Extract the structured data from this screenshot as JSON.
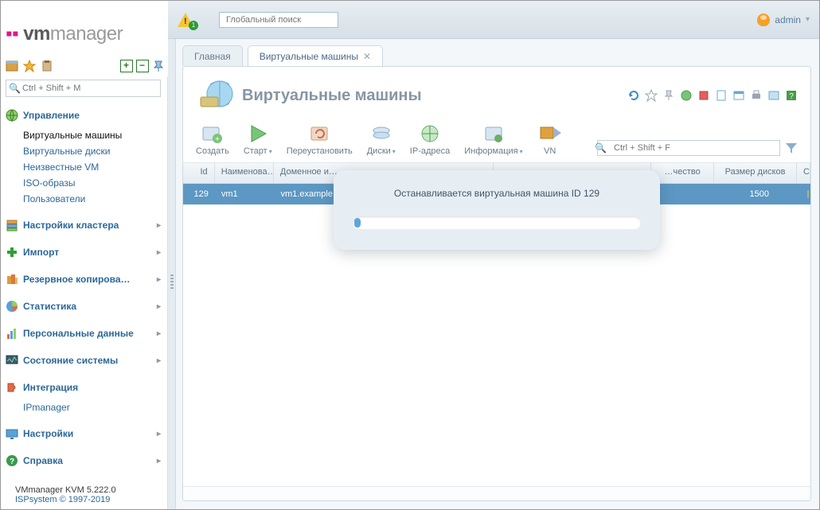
{
  "header": {
    "alert_count": "1",
    "search_placeholder": "Глобальный поиск",
    "user": "admin"
  },
  "logo": {
    "brand_prefix_symbol": "▪▪",
    "brand_bold": "vm",
    "brand_rest": "manager"
  },
  "mini_toolbar": {},
  "sidebar": {
    "search_placeholder": "Ctrl + Shift + M",
    "sections": [
      {
        "title": "Управление",
        "expandable": false,
        "items": [
          "Виртуальные машины",
          "Виртуальные диски",
          "Неизвестные VM",
          "ISO-образы",
          "Пользователи"
        ],
        "active_index": 0
      },
      {
        "title": "Настройки кластера",
        "expandable": true
      },
      {
        "title": "Импорт",
        "expandable": true
      },
      {
        "title": "Резервное копирова…",
        "expandable": true
      },
      {
        "title": "Статистика",
        "expandable": true
      },
      {
        "title": "Персональные данные",
        "expandable": true
      },
      {
        "title": "Состояние системы",
        "expandable": true
      },
      {
        "title": "Интеграция",
        "expandable": false,
        "items": [
          "IPmanager"
        ]
      },
      {
        "title": "Настройки",
        "expandable": true
      },
      {
        "title": "Справка",
        "expandable": true
      }
    ],
    "footer_version": "VMmanager KVM 5.222.0",
    "footer_copy": "ISPsystem © 1997-2019"
  },
  "tabs": [
    {
      "label": "Главная",
      "active": false,
      "closable": false
    },
    {
      "label": "Виртуальные машины",
      "active": true,
      "closable": true
    }
  ],
  "panel": {
    "title": "Виртуальные машины",
    "actions": [
      {
        "label": "Создать",
        "dropdown": false
      },
      {
        "label": "Старт",
        "dropdown": true
      },
      {
        "label": "Переустановить",
        "dropdown": false
      },
      {
        "label": "Диски",
        "dropdown": true
      },
      {
        "label": "IP-адреса",
        "dropdown": false
      },
      {
        "label": "Информация",
        "dropdown": true
      },
      {
        "label": "VN",
        "dropdown": false
      }
    ],
    "action_search_placeholder": "Ctrl + Shift + F",
    "columns": [
      "Id",
      "Наименова…",
      "Доменное и…",
      "",
      "…чество",
      "Размер дисков",
      "Состоя"
    ],
    "row": {
      "id": "129",
      "name": "vm1",
      "domain": "vm1.example",
      "disk_size": "1500"
    }
  },
  "modal": {
    "text": "Останавливается виртуальная машина ID 129"
  }
}
